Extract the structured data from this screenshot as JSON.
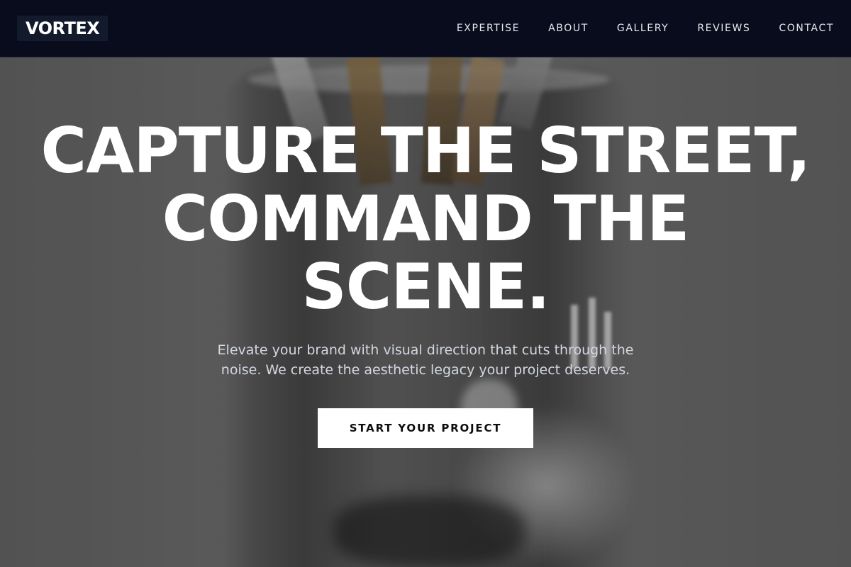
{
  "brand": {
    "logo_text": "VORTEX"
  },
  "nav": {
    "items": [
      {
        "label": "EXPERTISE"
      },
      {
        "label": "ABOUT"
      },
      {
        "label": "GALLERY"
      },
      {
        "label": "REVIEWS"
      },
      {
        "label": "CONTACT"
      }
    ]
  },
  "hero": {
    "title_line1": "CAPTURE THE STREET,",
    "title_line2": "COMMAND THE",
    "title_line3": "SCENE.",
    "subtitle": "Elevate your brand with visual direction that cuts through the noise. We create the aesthetic legacy your project deserves.",
    "cta_label": "START YOUR PROJECT",
    "background_image": "blurred-jar-with-paintbrushes-photo"
  },
  "colors": {
    "navbar_bg": "#080c1c",
    "logo_bg": "#121a2c",
    "text_primary": "#ffffff",
    "text_subtitle": "#d4d8e0",
    "cta_bg": "#ffffff",
    "cta_text": "#0d0d0d"
  }
}
